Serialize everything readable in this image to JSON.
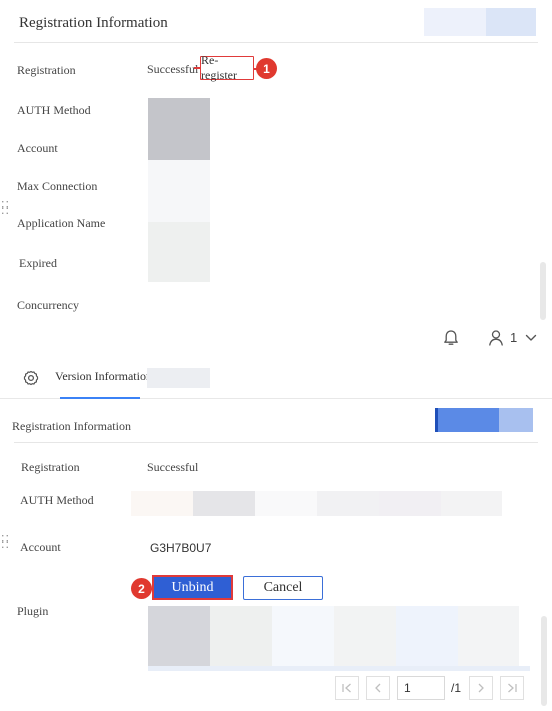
{
  "top_panel": {
    "section_title": "Registration Information",
    "rows": [
      {
        "label": "Registration",
        "value": "Successful"
      },
      {
        "label": "AUTH Method"
      },
      {
        "label": "Account"
      },
      {
        "label": "Max Connection"
      },
      {
        "label": "Application Name"
      },
      {
        "label": "Expired"
      },
      {
        "label": "Concurrency"
      }
    ],
    "reregister_label": "Re-register",
    "step_badge": "1"
  },
  "header_bar": {
    "user_count": "1"
  },
  "bottom_panel": {
    "tab_label": "Version Information",
    "section_title": "Registration Information",
    "rows": [
      {
        "label": "Registration",
        "value": "Successful"
      },
      {
        "label": "AUTH Method"
      },
      {
        "label": "Account",
        "value": "G3H7B0U7"
      },
      {
        "label": "Plugin"
      }
    ],
    "unbind_label": "Unbind",
    "cancel_label": "Cancel",
    "step_badge": "2",
    "pagination": {
      "current_page": "1",
      "total_pages": "/1"
    }
  },
  "colors": {
    "accent": "#3b82f6",
    "annotation_red": "#e0392f",
    "unbind_blue": "#2f5fd4"
  }
}
